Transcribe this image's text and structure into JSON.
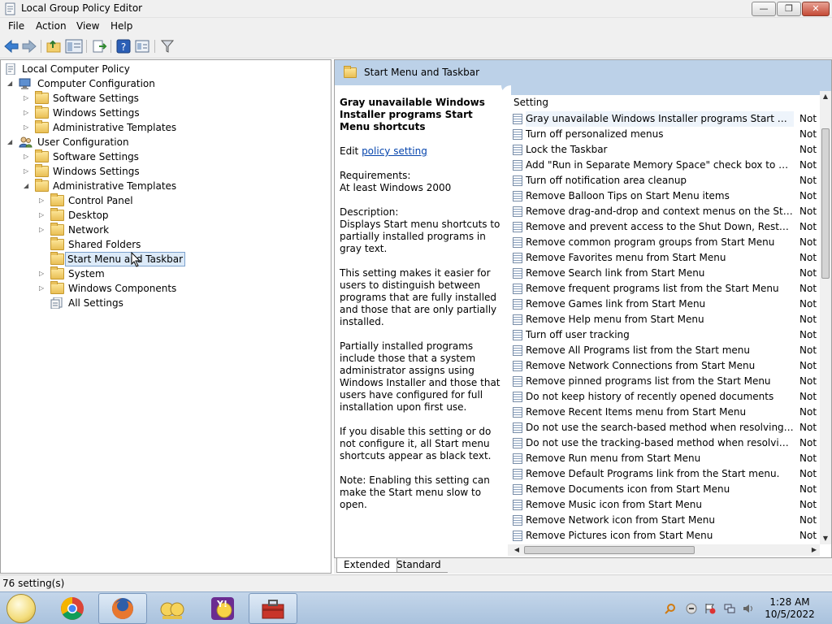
{
  "window": {
    "title": "Local Group Policy Editor"
  },
  "menu": [
    "File",
    "Action",
    "View",
    "Help"
  ],
  "tree": {
    "root": "Local Computer Policy",
    "computer_config": "Computer Configuration",
    "cc_software": "Software Settings",
    "cc_windows": "Windows Settings",
    "cc_admin": "Administrative Templates",
    "user_config": "User Configuration",
    "uc_software": "Software Settings",
    "uc_windows": "Windows Settings",
    "uc_admin": "Administrative Templates",
    "control_panel": "Control Panel",
    "desktop": "Desktop",
    "network": "Network",
    "shared_folders": "Shared Folders",
    "start_menu": "Start Menu and Taskbar",
    "system": "System",
    "windows_components": "Windows Components",
    "all_settings": "All Settings"
  },
  "pane": {
    "header": "Start Menu and Taskbar",
    "desc_title": "Gray unavailable Windows Installer programs Start Menu shortcuts",
    "edit_prefix": "Edit ",
    "edit_link": "policy setting",
    "req_label": "Requirements:",
    "req_value": "At least Windows 2000",
    "desc_label": "Description:",
    "desc_1": "Displays Start menu shortcuts to partially installed programs in gray text.",
    "desc_2": "This setting makes it easier for users to distinguish between programs that are fully installed and those that are only partially installed.",
    "desc_3": "Partially installed programs include those that a system administrator assigns using Windows Installer and those that users have configured for full installation upon first use.",
    "desc_4": "If you disable this setting or do not configure it, all Start menu shortcuts appear as black text.",
    "desc_5": "Note: Enabling this setting can make the Start menu slow to open."
  },
  "list": {
    "column_setting": "Setting",
    "rows": [
      {
        "name": "Gray unavailable Windows Installer programs Start Menu shortcuts",
        "state": "Not"
      },
      {
        "name": "Turn off personalized menus",
        "state": "Not"
      },
      {
        "name": "Lock the Taskbar",
        "state": "Not"
      },
      {
        "name": "Add \"Run in Separate Memory Space\" check box to Run dialog box",
        "state": "Not"
      },
      {
        "name": "Turn off notification area cleanup",
        "state": "Not"
      },
      {
        "name": "Remove Balloon Tips on Start Menu items",
        "state": "Not"
      },
      {
        "name": "Remove drag-and-drop and context menus on the Start Menu",
        "state": "Not"
      },
      {
        "name": "Remove and prevent access to the Shut Down, Restart, Sleep, and Hibernate commands",
        "state": "Not"
      },
      {
        "name": "Remove common program groups from Start Menu",
        "state": "Not"
      },
      {
        "name": "Remove Favorites menu from Start Menu",
        "state": "Not"
      },
      {
        "name": "Remove Search link from Start Menu",
        "state": "Not"
      },
      {
        "name": "Remove frequent programs list from the Start Menu",
        "state": "Not"
      },
      {
        "name": "Remove Games link from Start Menu",
        "state": "Not"
      },
      {
        "name": "Remove Help menu from Start Menu",
        "state": "Not"
      },
      {
        "name": "Turn off user tracking",
        "state": "Not"
      },
      {
        "name": "Remove All Programs list from the Start menu",
        "state": "Not"
      },
      {
        "name": "Remove Network Connections from Start Menu",
        "state": "Not"
      },
      {
        "name": "Remove pinned programs list from the Start Menu",
        "state": "Not"
      },
      {
        "name": "Do not keep history of recently opened documents",
        "state": "Not"
      },
      {
        "name": "Remove Recent Items menu from Start Menu",
        "state": "Not"
      },
      {
        "name": "Do not use the search-based method when resolving shell shortcuts",
        "state": "Not"
      },
      {
        "name": "Do not use the tracking-based method when resolving shell shortcuts",
        "state": "Not"
      },
      {
        "name": "Remove Run menu from Start Menu",
        "state": "Not"
      },
      {
        "name": "Remove Default Programs link from the Start menu.",
        "state": "Not"
      },
      {
        "name": "Remove Documents icon from Start Menu",
        "state": "Not"
      },
      {
        "name": "Remove Music icon from Start Menu",
        "state": "Not"
      },
      {
        "name": "Remove Network icon from Start Menu",
        "state": "Not"
      },
      {
        "name": "Remove Pictures icon from Start Menu",
        "state": "Not"
      }
    ]
  },
  "tabs": {
    "extended": "Extended",
    "standard": "Standard"
  },
  "status": "76 setting(s)",
  "clock": {
    "time": "1:28 AM",
    "date": "10/5/2022"
  }
}
